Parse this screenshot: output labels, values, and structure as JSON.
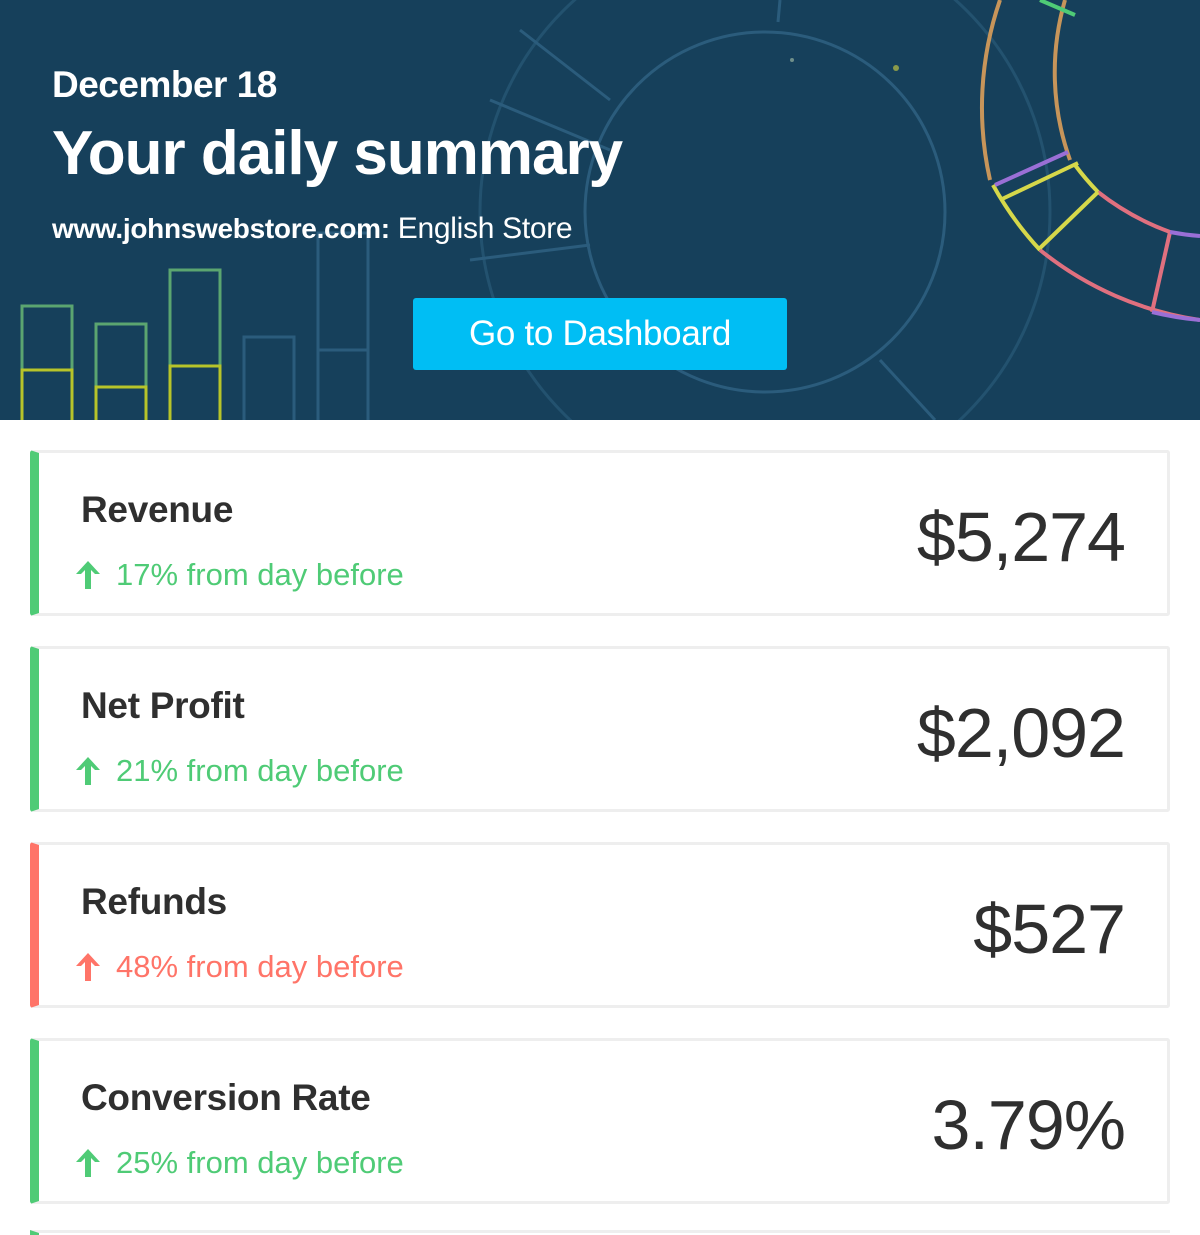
{
  "header": {
    "date": "December 18",
    "title": "Your daily summary",
    "store_domain": "www.johnswebstore.com:",
    "store_name": " English Store",
    "cta_label": "Go to Dashboard"
  },
  "metrics": [
    {
      "label": "Revenue",
      "change": "17% from day before",
      "value": "$5,274",
      "trend": "up",
      "sentiment": "positive"
    },
    {
      "label": "Net Profit",
      "change": "21% from day before",
      "value": "$2,092",
      "trend": "up",
      "sentiment": "positive"
    },
    {
      "label": "Refunds",
      "change": "48% from day before",
      "value": "$527",
      "trend": "up",
      "sentiment": "negative"
    },
    {
      "label": "Conversion Rate",
      "change": "25% from day before",
      "value": "3.79%",
      "trend": "up",
      "sentiment": "positive"
    }
  ],
  "colors": {
    "header_bg": "#16405b",
    "cta_bg": "#00bef4",
    "positive": "#4fcb76",
    "negative": "#ff7468",
    "text_dark": "#2f2f2f",
    "card_border": "#eeeeee"
  },
  "icons": {
    "trend_up": "arrow-up-icon"
  }
}
